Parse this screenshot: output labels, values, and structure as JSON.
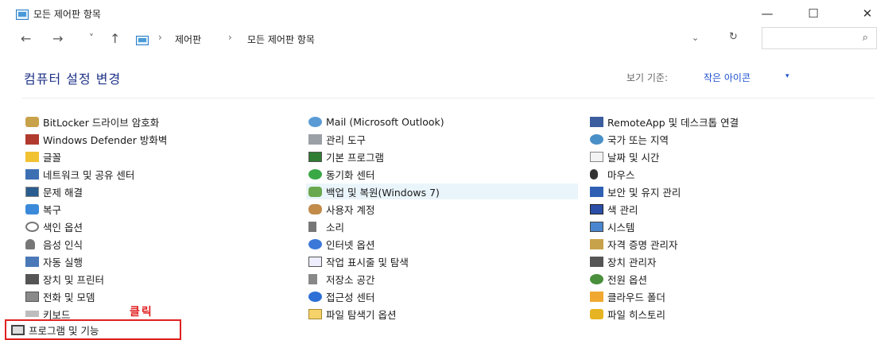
{
  "window": {
    "title": "모든 제어판 항목",
    "minimize": "—",
    "maximize": "☐",
    "close": "✕"
  },
  "nav": {
    "back": "←",
    "forward": "→",
    "recent": "˅",
    "up": "↑"
  },
  "address": {
    "crumbs": [
      "제어판",
      "모든 제어판 항목"
    ],
    "sep": "›",
    "dropdown": "⌄",
    "refresh": "↻"
  },
  "search": {
    "placeholder": "",
    "icon": "⌕"
  },
  "main": {
    "heading": "컴퓨터 설정 변경",
    "viewby_label": "보기 기준:",
    "viewby_value": "작은 아이콘",
    "viewby_arrow": "▾"
  },
  "columns": [
    [
      "BitLocker 드라이브 암호화",
      "Windows Defender 방화벽",
      "글꼴",
      "네트워크 및 공유 센터",
      "문제 해결",
      "복구",
      "색인 옵션",
      "음성 인식",
      "자동 실행",
      "장치 및 프린터",
      "전화 및 모뎀",
      "키보드",
      "프로그램 및 기능"
    ],
    [
      "Mail (Microsoft Outlook)",
      "관리 도구",
      "기본 프로그램",
      "동기화 센터",
      "백업 및 복원(Windows 7)",
      "사용자 계정",
      "소리",
      "인터넷 옵션",
      "작업 표시줄 및 탐색",
      "저장소 공간",
      "접근성 센터",
      "파일 탐색기 옵션"
    ],
    [
      "RemoteApp 및 데스크톱 연결",
      "국가 또는 지역",
      "날짜 및 시간",
      "마우스",
      "보안 및 유지 관리",
      "색 관리",
      "시스템",
      "자격 증명 관리자",
      "장치 관리자",
      "전원 옵션",
      "클라우드 폴더",
      "파일 히스토리"
    ]
  ],
  "annotation": {
    "click_label": "클릭"
  },
  "colors": {
    "heading": "#1e3287",
    "link": "#2050d0",
    "highlight": "#eaf5fb",
    "annotation": "#e02020"
  }
}
